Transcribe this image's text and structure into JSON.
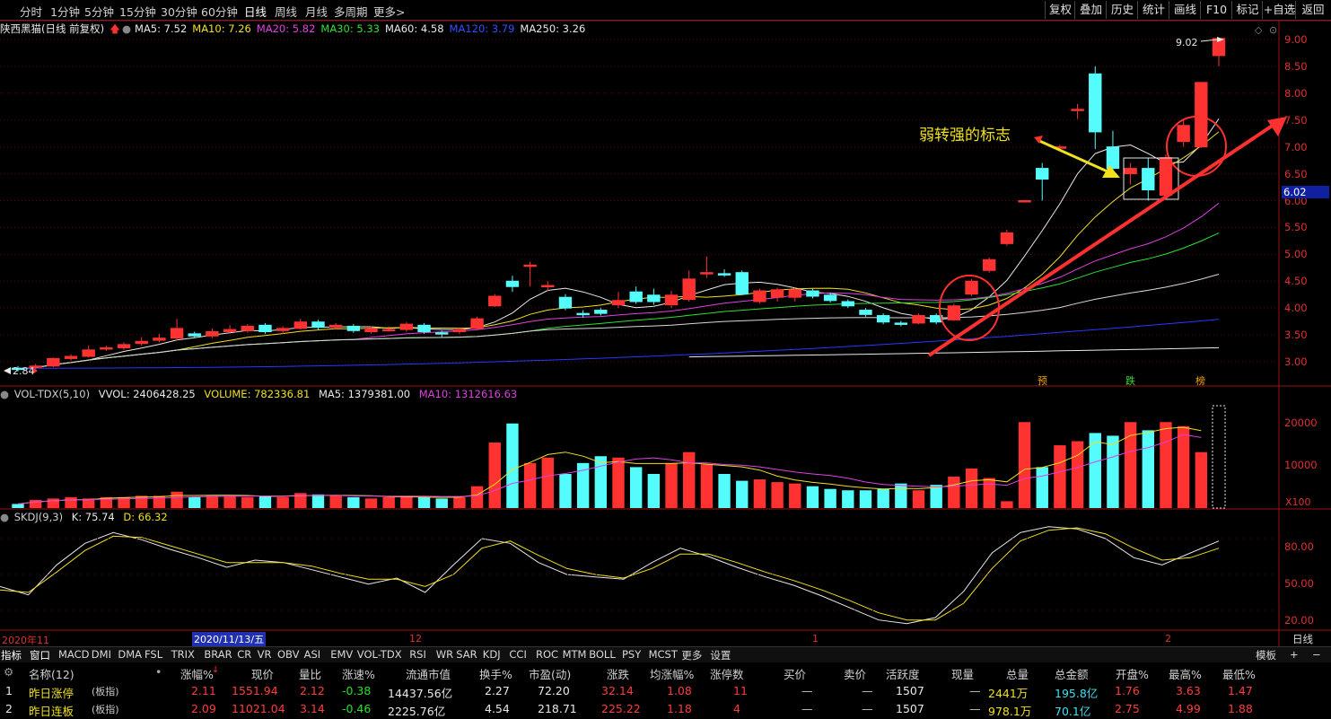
{
  "periods": [
    "分时",
    "1分钟",
    "5分钟",
    "15分钟",
    "30分钟",
    "60分钟",
    "日线",
    "周线",
    "月线",
    "多周期",
    "更多>"
  ],
  "active_period": "日线",
  "toolbar": [
    "复权",
    "叠加",
    "历史",
    "统计",
    "画线",
    "F10",
    "标记",
    "+自选",
    "返回"
  ],
  "main_header": {
    "title": "陕西黑猫(日线 前复权)",
    "ma": [
      {
        "label": "MA5: 7.52",
        "color": "#e8e8e8"
      },
      {
        "label": "MA10: 7.26",
        "color": "#f0e020"
      },
      {
        "label": "MA20: 5.82",
        "color": "#e040e0"
      },
      {
        "label": "MA30: 5.33",
        "color": "#30e030"
      },
      {
        "label": "MA60: 4.58",
        "color": "#e8e8e8"
      },
      {
        "label": "MA120: 3.79",
        "color": "#3050ff"
      },
      {
        "label": "MA250: 3.26",
        "color": "#e8e8e8"
      }
    ]
  },
  "price_scale": [
    "9.00",
    "8.50",
    "8.00",
    "7.50",
    "7.00",
    "6.50",
    "6.00",
    "5.50",
    "5.00",
    "4.50",
    "4.00",
    "3.50",
    "3.00"
  ],
  "current_price": "6.02",
  "high_label": "9.02",
  "low_label": "2.84",
  "annotation": "弱转强的标志",
  "markers": [
    "预",
    "跌",
    "榜"
  ],
  "vol_header": {
    "name": "VOL-TDX(5,10)",
    "vvol": "VVOL: 2406428.25",
    "volume": "VOLUME: 782336.81",
    "ma5": "MA5: 1379381.00",
    "ma10": "MA10: 1312616.63"
  },
  "vol_scale": [
    "20000",
    "10000"
  ],
  "vol_unit": "X100",
  "kdj_header": {
    "name": "SKDJ(9,3)",
    "k": "K: 75.74",
    "d": "D: 66.32"
  },
  "kdj_scale": [
    "80.00",
    "50.00",
    "20.00"
  ],
  "date_axis": {
    "start": "2020年11",
    "cursor": "2020/11/13/五",
    "m12": "12",
    "m1": "1",
    "m2": "2"
  },
  "tabs": [
    "指标",
    "窗口",
    "MACD",
    "DMI",
    "DMA",
    "FSL",
    "TRIX",
    "BRAR",
    "CR",
    "VR",
    "OBV",
    "ASI",
    "EMV",
    "VOL-TDX",
    "RSI",
    "WR",
    "SAR",
    "KDJ",
    "CCI",
    "ROC",
    "MTM",
    "BOLL",
    "PSY",
    "MCST",
    "更多",
    "设置"
  ],
  "tabs_right": [
    "模板",
    "+",
    "−",
    "日线"
  ],
  "table": {
    "headers": [
      "名称(12)",
      "涨幅%",
      "现价",
      "量比",
      "涨速%",
      "流通市值",
      "换手%",
      "市盈(动)",
      "涨跌",
      "均涨幅%",
      "涨停数",
      "买价",
      "卖价",
      "活跃度",
      "现量",
      "总量",
      "总金额",
      "开盘%",
      "最高%",
      "最低%"
    ],
    "rows": [
      [
        "1",
        "昨日涨停",
        "(板指)",
        "2.11",
        "1551.94",
        "2.12",
        "-0.38",
        "14437.56亿",
        "2.27",
        "72.20",
        "32.14",
        "1.08",
        "11",
        "—",
        "—",
        "1507",
        "—",
        "2441万",
        "195.8亿",
        "1.76",
        "3.63",
        "1.47"
      ],
      [
        "2",
        "昨日连板",
        "(板指)",
        "2.09",
        "11021.04",
        "3.14",
        "-0.46",
        "2225.76亿",
        "4.54",
        "218.71",
        "225.22",
        "1.18",
        "4",
        "—",
        "—",
        "1507",
        "—",
        "978.1万",
        "70.1亿",
        "2.75",
        "4.99",
        "1.88"
      ]
    ]
  },
  "chart_data": {
    "type": "candlestick",
    "title": "陕西黑猫(日线 前复权)",
    "ylim": [
      2.7,
      9.1
    ],
    "candles": [
      {
        "o": 2.88,
        "c": 2.86,
        "h": 2.92,
        "l": 2.82
      },
      {
        "o": 2.9,
        "c": 2.92,
        "h": 2.96,
        "l": 2.86
      },
      {
        "o": 2.92,
        "c": 3.06,
        "h": 3.08,
        "l": 2.9
      },
      {
        "o": 3.06,
        "c": 3.1,
        "h": 3.14,
        "l": 3.02
      },
      {
        "o": 3.1,
        "c": 3.22,
        "h": 3.3,
        "l": 3.08
      },
      {
        "o": 3.24,
        "c": 3.26,
        "h": 3.3,
        "l": 3.2
      },
      {
        "o": 3.26,
        "c": 3.32,
        "h": 3.36,
        "l": 3.22
      },
      {
        "o": 3.34,
        "c": 3.38,
        "h": 3.46,
        "l": 3.3
      },
      {
        "o": 3.4,
        "c": 3.44,
        "h": 3.52,
        "l": 3.36
      },
      {
        "o": 3.44,
        "c": 3.62,
        "h": 3.8,
        "l": 3.4
      },
      {
        "o": 3.52,
        "c": 3.48,
        "h": 3.56,
        "l": 3.44
      },
      {
        "o": 3.48,
        "c": 3.56,
        "h": 3.62,
        "l": 3.44
      },
      {
        "o": 3.56,
        "c": 3.6,
        "h": 3.68,
        "l": 3.52
      },
      {
        "o": 3.58,
        "c": 3.66,
        "h": 3.7,
        "l": 3.54
      },
      {
        "o": 3.68,
        "c": 3.56,
        "h": 3.72,
        "l": 3.52
      },
      {
        "o": 3.58,
        "c": 3.62,
        "h": 3.66,
        "l": 3.52
      },
      {
        "o": 3.62,
        "c": 3.74,
        "h": 3.8,
        "l": 3.6
      },
      {
        "o": 3.74,
        "c": 3.64,
        "h": 3.78,
        "l": 3.6
      },
      {
        "o": 3.64,
        "c": 3.68,
        "h": 3.72,
        "l": 3.6
      },
      {
        "o": 3.66,
        "c": 3.58,
        "h": 3.7,
        "l": 3.54
      },
      {
        "o": 3.56,
        "c": 3.62,
        "h": 3.66,
        "l": 3.52
      },
      {
        "o": 3.6,
        "c": 3.6,
        "h": 3.66,
        "l": 3.56
      },
      {
        "o": 3.6,
        "c": 3.7,
        "h": 3.74,
        "l": 3.56
      },
      {
        "o": 3.68,
        "c": 3.56,
        "h": 3.72,
        "l": 3.52
      },
      {
        "o": 3.54,
        "c": 3.52,
        "h": 3.58,
        "l": 3.46
      },
      {
        "o": 3.56,
        "c": 3.6,
        "h": 3.62,
        "l": 3.52
      },
      {
        "o": 3.62,
        "c": 3.8,
        "h": 3.84,
        "l": 3.6
      },
      {
        "o": 4.04,
        "c": 4.22,
        "h": 4.26,
        "l": 4.02
      },
      {
        "o": 4.5,
        "c": 4.4,
        "h": 4.6,
        "l": 4.3
      },
      {
        "o": 4.8,
        "c": 4.8,
        "h": 4.86,
        "l": 4.4
      },
      {
        "o": 4.42,
        "c": 4.42,
        "h": 4.5,
        "l": 4.32
      },
      {
        "o": 4.2,
        "c": 4.0,
        "h": 4.26,
        "l": 3.96
      },
      {
        "o": 3.9,
        "c": 3.88,
        "h": 3.96,
        "l": 3.82
      },
      {
        "o": 3.96,
        "c": 3.9,
        "h": 4.0,
        "l": 3.86
      },
      {
        "o": 4.06,
        "c": 4.14,
        "h": 4.3,
        "l": 4.0
      },
      {
        "o": 4.3,
        "c": 4.12,
        "h": 4.4,
        "l": 4.08
      },
      {
        "o": 4.24,
        "c": 4.12,
        "h": 4.36,
        "l": 4.06
      },
      {
        "o": 4.06,
        "c": 4.24,
        "h": 4.32,
        "l": 4.0
      },
      {
        "o": 4.16,
        "c": 4.54,
        "h": 4.7,
        "l": 4.12
      },
      {
        "o": 4.66,
        "c": 4.66,
        "h": 4.96,
        "l": 4.56
      },
      {
        "o": 4.64,
        "c": 4.62,
        "h": 4.72,
        "l": 4.58
      },
      {
        "o": 4.66,
        "c": 4.26,
        "h": 4.7,
        "l": 4.24
      },
      {
        "o": 4.12,
        "c": 4.32,
        "h": 4.36,
        "l": 4.08
      },
      {
        "o": 4.2,
        "c": 4.34,
        "h": 4.38,
        "l": 4.12
      },
      {
        "o": 4.2,
        "c": 4.34,
        "h": 4.38,
        "l": 4.12
      },
      {
        "o": 4.32,
        "c": 4.22,
        "h": 4.36,
        "l": 4.18
      },
      {
        "o": 4.24,
        "c": 4.14,
        "h": 4.28,
        "l": 4.1
      },
      {
        "o": 4.12,
        "c": 4.04,
        "h": 4.16,
        "l": 4.0
      },
      {
        "o": 3.96,
        "c": 3.88,
        "h": 4.0,
        "l": 3.84
      },
      {
        "o": 3.86,
        "c": 3.74,
        "h": 3.9,
        "l": 3.7
      },
      {
        "o": 3.72,
        "c": 3.7,
        "h": 3.76,
        "l": 3.66
      },
      {
        "o": 3.72,
        "c": 3.86,
        "h": 3.9,
        "l": 3.7
      },
      {
        "o": 3.86,
        "c": 3.74,
        "h": 3.9,
        "l": 3.7
      },
      {
        "o": 3.78,
        "c": 4.04,
        "h": 4.08,
        "l": 3.76
      },
      {
        "o": 4.26,
        "c": 4.5,
        "h": 4.54,
        "l": 4.22
      },
      {
        "o": 4.7,
        "c": 4.9,
        "h": 4.94,
        "l": 4.66
      },
      {
        "o": 5.2,
        "c": 5.4,
        "h": 5.46,
        "l": 5.16
      },
      {
        "o": 6.0,
        "c": 6.0,
        "h": 6.0,
        "l": 6.0
      },
      {
        "o": 6.6,
        "c": 6.4,
        "h": 6.7,
        "l": 6.0
      },
      {
        "o": 7.0,
        "c": 7.0,
        "h": 7.04,
        "l": 6.96
      },
      {
        "o": 7.7,
        "c": 7.7,
        "h": 7.8,
        "l": 7.52
      },
      {
        "o": 8.36,
        "c": 7.28,
        "h": 8.5,
        "l": 6.96
      },
      {
        "o": 7.0,
        "c": 6.6,
        "h": 7.3,
        "l": 6.52
      },
      {
        "o": 6.5,
        "c": 6.6,
        "h": 6.7,
        "l": 6.3
      },
      {
        "o": 6.6,
        "c": 6.2,
        "h": 6.8,
        "l": 6.0
      },
      {
        "o": 6.1,
        "c": 6.8,
        "h": 6.86,
        "l": 6.06
      },
      {
        "o": 7.1,
        "c": 7.4,
        "h": 7.5,
        "l": 7.0
      },
      {
        "o": 7.0,
        "c": 8.2,
        "h": 8.2,
        "l": 6.98
      },
      {
        "o": 8.7,
        "c": 9.02,
        "h": 9.02,
        "l": 8.5
      }
    ],
    "volume": [
      3,
      6,
      7,
      8,
      7,
      8,
      8,
      9,
      9,
      12,
      8,
      9,
      9,
      8,
      9,
      8,
      11,
      10,
      9,
      8,
      7,
      8,
      9,
      8,
      7,
      8,
      16,
      48,
      62,
      33,
      37,
      25,
      33,
      38,
      37,
      30,
      25,
      33,
      41,
      32,
      25,
      20,
      21,
      19,
      18,
      16,
      14,
      13,
      13,
      14,
      18,
      13,
      17,
      23,
      29,
      22,
      5,
      63,
      30,
      46,
      49,
      55,
      53,
      63,
      57,
      63,
      60,
      41
    ]
  }
}
